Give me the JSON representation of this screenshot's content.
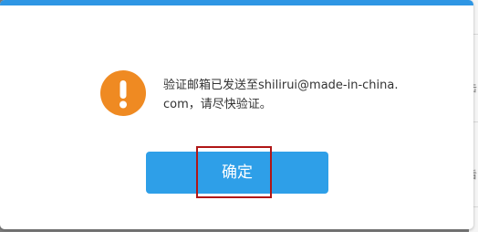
{
  "dialog": {
    "message": "验证邮箱已发送至shilirui@made-in-china.com，请尽快验证。",
    "confirm_label": "确定",
    "accent_color": "#2e96e4",
    "icon": "exclamation-icon",
    "icon_color": "#ef8a22"
  },
  "background_page": {
    "fragments": [
      "击",
      "看"
    ]
  }
}
